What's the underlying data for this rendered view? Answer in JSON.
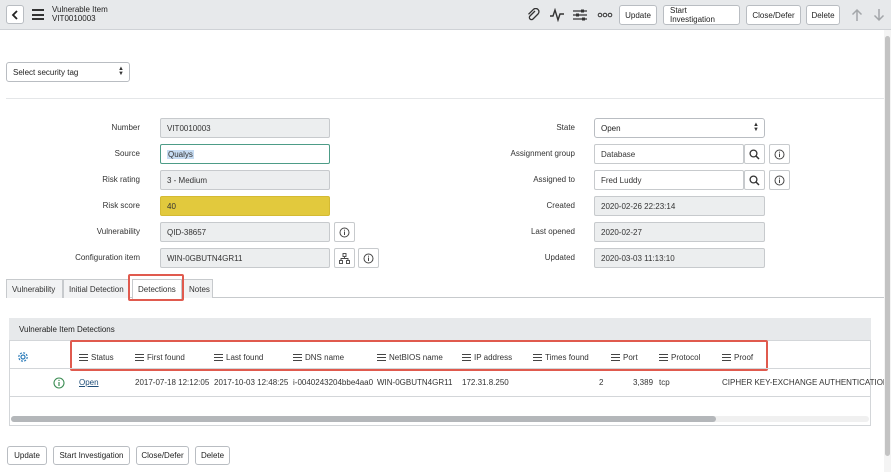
{
  "header": {
    "title": "Vulnerable Item",
    "record_number": "VIT0010003",
    "buttons": {
      "update": "Update",
      "start_investigation": "Start Investigation",
      "close_defer": "Close/Defer",
      "delete": "Delete"
    },
    "icons": [
      "back-icon",
      "menu-icon",
      "attachment-icon",
      "activity-icon",
      "personalize-icon",
      "more-icon",
      "arrow-up-icon",
      "arrow-down-icon"
    ]
  },
  "security_tag": {
    "value": "Select security tag"
  },
  "form": {
    "left": {
      "number": {
        "label": "Number",
        "value": "VIT0010003"
      },
      "source": {
        "label": "Source",
        "value": "Qualys"
      },
      "risk_rating": {
        "label": "Risk rating",
        "value": "3 - Medium"
      },
      "risk_score": {
        "label": "Risk score",
        "value": "40"
      },
      "vulnerability": {
        "label": "Vulnerability",
        "value": "QID-38657"
      },
      "configuration_item": {
        "label": "Configuration item",
        "value": "WIN-0GBUTN4GR11"
      }
    },
    "right": {
      "state": {
        "label": "State",
        "value": "Open"
      },
      "assignment_group": {
        "label": "Assignment group",
        "value": "Database"
      },
      "assigned_to": {
        "label": "Assigned to",
        "value": "Fred Luddy"
      },
      "created": {
        "label": "Created",
        "value": "2020-02-26 22:23:14"
      },
      "last_opened": {
        "label": "Last opened",
        "value": "2020-02-27"
      },
      "updated": {
        "label": "Updated",
        "value": "2020-03-03 11:13:10"
      }
    }
  },
  "tabs": [
    "Vulnerability",
    "Initial Detection",
    "Detections",
    "Notes"
  ],
  "active_tab": "Detections",
  "detections": {
    "title": "Vulnerable Item Detections",
    "columns": [
      "Status",
      "First found",
      "Last found",
      "DNS name",
      "NetBIOS name",
      "IP address",
      "Times found",
      "Port",
      "Protocol",
      "Proof"
    ],
    "rows": [
      {
        "status": "Open",
        "first_found": "2017-07-18 12:12:05",
        "last_found": "2017-10-03 12:48:25",
        "dns_name": "i-0040243204bbe4aa0",
        "netbios_name": "WIN-0GBUTN4GR11",
        "ip_address": "172.31.8.250",
        "times_found": "2",
        "port": "3,389",
        "protocol": "tcp",
        "proof": "CIPHER KEY-EXCHANGE AUTHENTICATION"
      }
    ]
  },
  "footer_buttons": {
    "update": "Update",
    "start_investigation": "Start Investigation",
    "close_defer": "Close/Defer",
    "delete": "Delete"
  },
  "colors": {
    "highlight": "#e05a4e",
    "risk_score_bg": "#e2c93d",
    "focus_border": "#4d9c87"
  }
}
